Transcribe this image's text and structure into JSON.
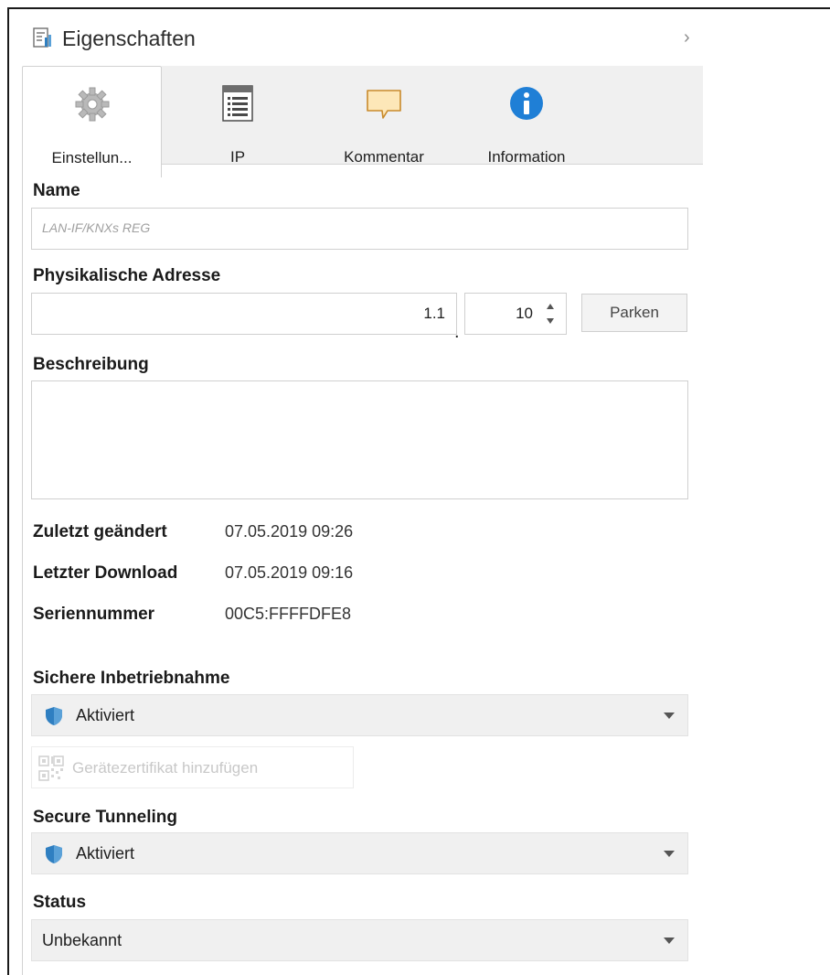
{
  "header": {
    "title": "Eigenschaften",
    "icon": "properties-icon",
    "collapse_icon": "chevron-right-icon"
  },
  "tabs": [
    {
      "label": "Einstellun...",
      "icon": "gear-icon",
      "active": true
    },
    {
      "label": "IP",
      "icon": "ip-list-icon",
      "active": false
    },
    {
      "label": "Kommentar",
      "icon": "comment-icon",
      "active": false
    },
    {
      "label": "Information",
      "icon": "info-icon",
      "active": false
    }
  ],
  "name": {
    "label": "Name",
    "placeholder": "LAN-IF/KNXs REG"
  },
  "address": {
    "label": "Physikalische Adresse",
    "area_line": "1.1",
    "separator": ".",
    "device": "10",
    "park_label": "Parken"
  },
  "description": {
    "label": "Beschreibung",
    "value": ""
  },
  "info": [
    {
      "key": "Zuletzt geändert",
      "value": "07.05.2019 09:26"
    },
    {
      "key": "Letzter Download",
      "value": "07.05.2019 09:16"
    },
    {
      "key": "Seriennummer",
      "value": "00C5:FFFFDFE8"
    }
  ],
  "secure_commissioning": {
    "label": "Sichere Inbetriebnahme",
    "selected": "Aktiviert"
  },
  "certificate_button": {
    "label": "Gerätezertifikat hinzufügen",
    "enabled": false
  },
  "secure_tunneling": {
    "label": "Secure Tunneling",
    "selected": "Aktiviert"
  },
  "status": {
    "label": "Status",
    "selected": "Unbekannt"
  },
  "colors": {
    "shield": "#2f7fc1",
    "info": "#1f7fd6",
    "comment": "#f5c46a",
    "tab_strip": "#f0f0f0",
    "dropdown": "#f0f0f0"
  }
}
